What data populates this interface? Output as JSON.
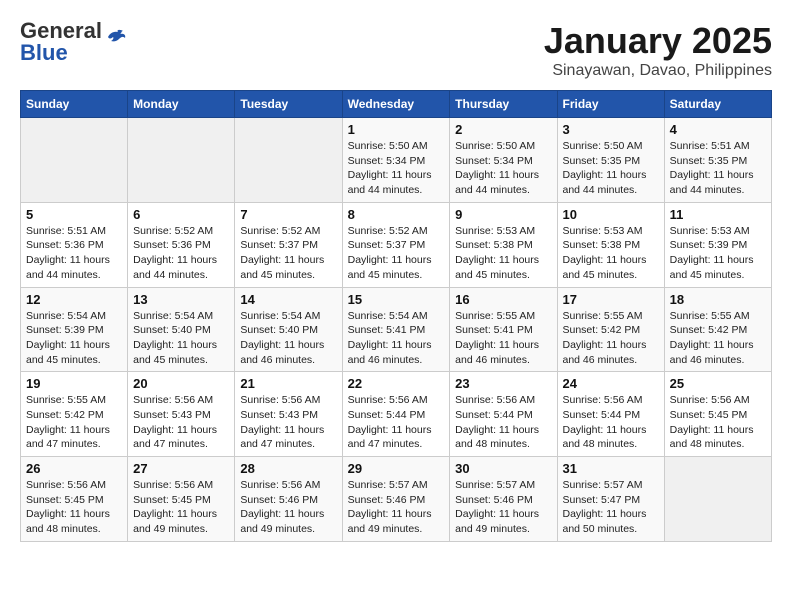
{
  "logo": {
    "general": "General",
    "blue": "Blue"
  },
  "title": "January 2025",
  "subtitle": "Sinayawan, Davao, Philippines",
  "headers": [
    "Sunday",
    "Monday",
    "Tuesday",
    "Wednesday",
    "Thursday",
    "Friday",
    "Saturday"
  ],
  "weeks": [
    [
      {
        "day": "",
        "info": ""
      },
      {
        "day": "",
        "info": ""
      },
      {
        "day": "",
        "info": ""
      },
      {
        "day": "1",
        "info": "Sunrise: 5:50 AM\nSunset: 5:34 PM\nDaylight: 11 hours and 44 minutes."
      },
      {
        "day": "2",
        "info": "Sunrise: 5:50 AM\nSunset: 5:34 PM\nDaylight: 11 hours and 44 minutes."
      },
      {
        "day": "3",
        "info": "Sunrise: 5:50 AM\nSunset: 5:35 PM\nDaylight: 11 hours and 44 minutes."
      },
      {
        "day": "4",
        "info": "Sunrise: 5:51 AM\nSunset: 5:35 PM\nDaylight: 11 hours and 44 minutes."
      }
    ],
    [
      {
        "day": "5",
        "info": "Sunrise: 5:51 AM\nSunset: 5:36 PM\nDaylight: 11 hours and 44 minutes."
      },
      {
        "day": "6",
        "info": "Sunrise: 5:52 AM\nSunset: 5:36 PM\nDaylight: 11 hours and 44 minutes."
      },
      {
        "day": "7",
        "info": "Sunrise: 5:52 AM\nSunset: 5:37 PM\nDaylight: 11 hours and 45 minutes."
      },
      {
        "day": "8",
        "info": "Sunrise: 5:52 AM\nSunset: 5:37 PM\nDaylight: 11 hours and 45 minutes."
      },
      {
        "day": "9",
        "info": "Sunrise: 5:53 AM\nSunset: 5:38 PM\nDaylight: 11 hours and 45 minutes."
      },
      {
        "day": "10",
        "info": "Sunrise: 5:53 AM\nSunset: 5:38 PM\nDaylight: 11 hours and 45 minutes."
      },
      {
        "day": "11",
        "info": "Sunrise: 5:53 AM\nSunset: 5:39 PM\nDaylight: 11 hours and 45 minutes."
      }
    ],
    [
      {
        "day": "12",
        "info": "Sunrise: 5:54 AM\nSunset: 5:39 PM\nDaylight: 11 hours and 45 minutes."
      },
      {
        "day": "13",
        "info": "Sunrise: 5:54 AM\nSunset: 5:40 PM\nDaylight: 11 hours and 45 minutes."
      },
      {
        "day": "14",
        "info": "Sunrise: 5:54 AM\nSunset: 5:40 PM\nDaylight: 11 hours and 46 minutes."
      },
      {
        "day": "15",
        "info": "Sunrise: 5:54 AM\nSunset: 5:41 PM\nDaylight: 11 hours and 46 minutes."
      },
      {
        "day": "16",
        "info": "Sunrise: 5:55 AM\nSunset: 5:41 PM\nDaylight: 11 hours and 46 minutes."
      },
      {
        "day": "17",
        "info": "Sunrise: 5:55 AM\nSunset: 5:42 PM\nDaylight: 11 hours and 46 minutes."
      },
      {
        "day": "18",
        "info": "Sunrise: 5:55 AM\nSunset: 5:42 PM\nDaylight: 11 hours and 46 minutes."
      }
    ],
    [
      {
        "day": "19",
        "info": "Sunrise: 5:55 AM\nSunset: 5:42 PM\nDaylight: 11 hours and 47 minutes."
      },
      {
        "day": "20",
        "info": "Sunrise: 5:56 AM\nSunset: 5:43 PM\nDaylight: 11 hours and 47 minutes."
      },
      {
        "day": "21",
        "info": "Sunrise: 5:56 AM\nSunset: 5:43 PM\nDaylight: 11 hours and 47 minutes."
      },
      {
        "day": "22",
        "info": "Sunrise: 5:56 AM\nSunset: 5:44 PM\nDaylight: 11 hours and 47 minutes."
      },
      {
        "day": "23",
        "info": "Sunrise: 5:56 AM\nSunset: 5:44 PM\nDaylight: 11 hours and 48 minutes."
      },
      {
        "day": "24",
        "info": "Sunrise: 5:56 AM\nSunset: 5:44 PM\nDaylight: 11 hours and 48 minutes."
      },
      {
        "day": "25",
        "info": "Sunrise: 5:56 AM\nSunset: 5:45 PM\nDaylight: 11 hours and 48 minutes."
      }
    ],
    [
      {
        "day": "26",
        "info": "Sunrise: 5:56 AM\nSunset: 5:45 PM\nDaylight: 11 hours and 48 minutes."
      },
      {
        "day": "27",
        "info": "Sunrise: 5:56 AM\nSunset: 5:45 PM\nDaylight: 11 hours and 49 minutes."
      },
      {
        "day": "28",
        "info": "Sunrise: 5:56 AM\nSunset: 5:46 PM\nDaylight: 11 hours and 49 minutes."
      },
      {
        "day": "29",
        "info": "Sunrise: 5:57 AM\nSunset: 5:46 PM\nDaylight: 11 hours and 49 minutes."
      },
      {
        "day": "30",
        "info": "Sunrise: 5:57 AM\nSunset: 5:46 PM\nDaylight: 11 hours and 49 minutes."
      },
      {
        "day": "31",
        "info": "Sunrise: 5:57 AM\nSunset: 5:47 PM\nDaylight: 11 hours and 50 minutes."
      },
      {
        "day": "",
        "info": ""
      }
    ]
  ]
}
